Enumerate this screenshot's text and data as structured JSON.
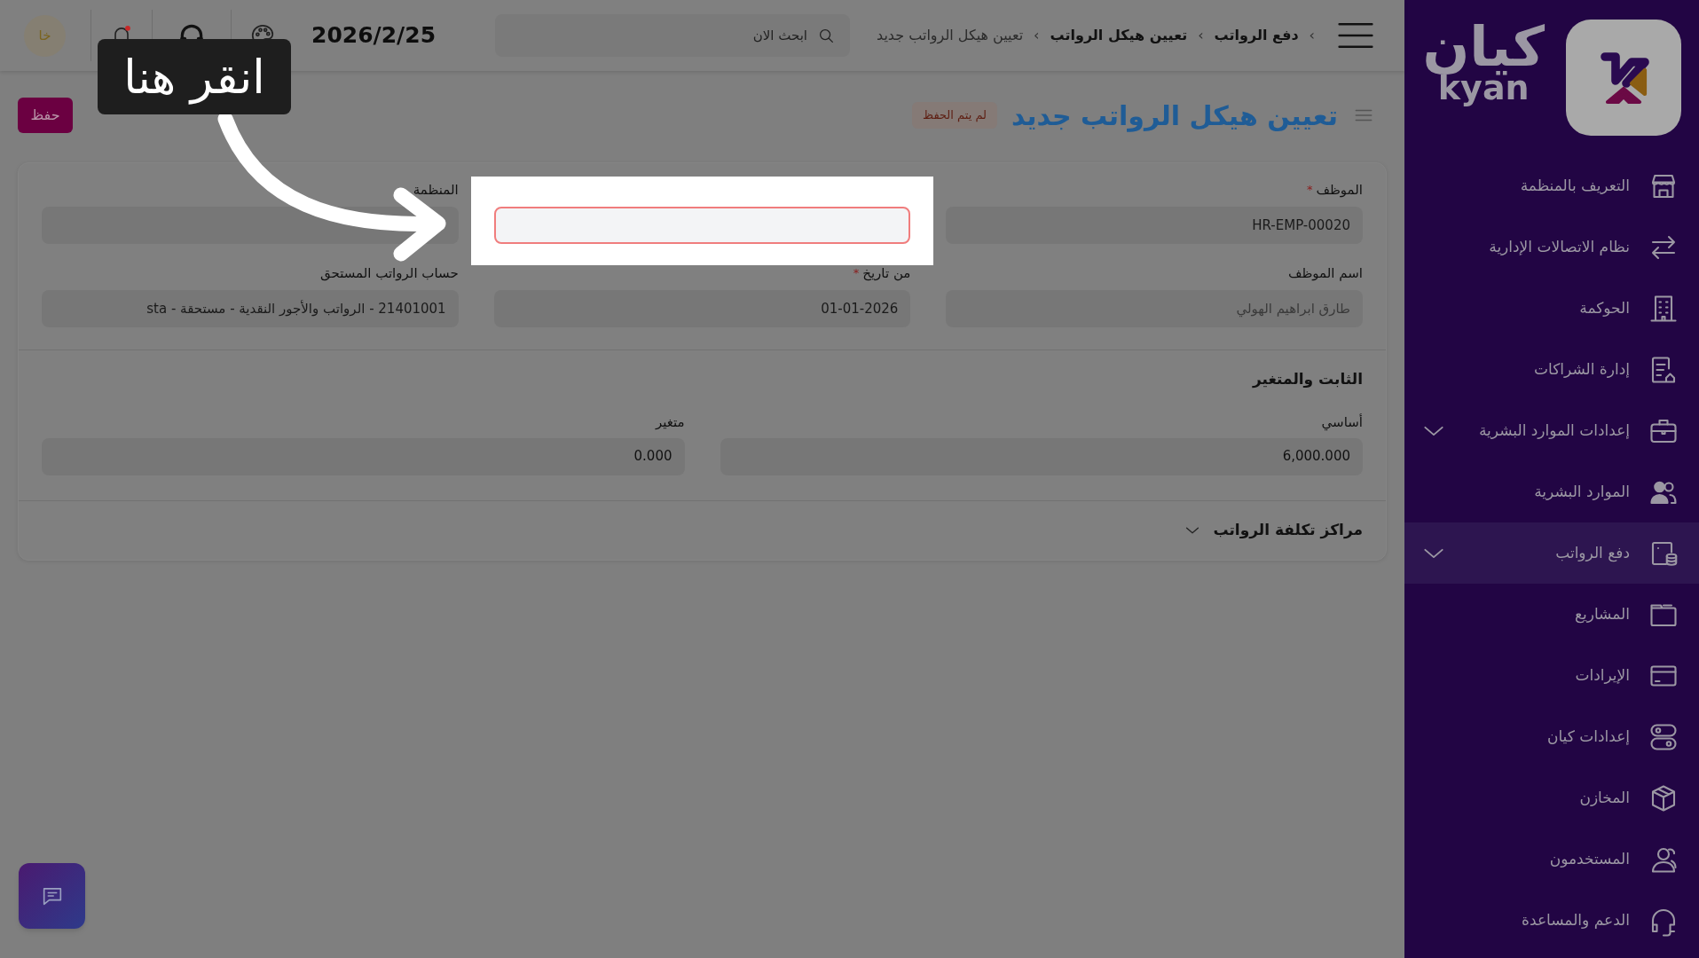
{
  "topbar": {
    "breadcrumbs": [
      {
        "label": "دفع الرواتب",
        "current": false
      },
      {
        "label": "تعيين هيكل الرواتب",
        "current": false
      },
      {
        "label": "تعيين هيكل الرواتب جديد",
        "current": true
      }
    ],
    "breadcrumb_separator": "›",
    "search": {
      "placeholder": "ابحث الان"
    },
    "date": "2026/2/25",
    "notification_dot": true,
    "avatar": "خا"
  },
  "page": {
    "title": "تعيين هيكل الرواتب جديد",
    "status_badge": "لم يتم الحفظ",
    "save_button": "حفظ"
  },
  "form": {
    "rows": [
      [
        {
          "label": "الموظف",
          "required": true,
          "value": "HR-EMP-00020",
          "highlighted": false
        },
        {
          "highlighted": true
        },
        {
          "label": "المنظمة",
          "required": false,
          "highlighted": false
        }
      ],
      [
        {
          "label": "اسم الموظف",
          "required": false,
          "value": "طارق ابراهيم الهولي",
          "highlighted": false,
          "readonly": true
        },
        {
          "label": "من تاريخ",
          "required": true,
          "value": "01-01-2026",
          "highlighted": false
        },
        {
          "label": "حساب الرواتب المستحق",
          "required": false,
          "value": "21401001 - الرواتب والأجور النقدية - مستحقة - sta",
          "highlighted": false
        }
      ]
    ],
    "required_mark": "*",
    "section_title": "الثابت والمتغير",
    "amounts": [
      {
        "label": "أساسي",
        "value": "6,000.000"
      },
      {
        "label": "متغير",
        "value": "0.000"
      }
    ],
    "collapsible": {
      "title": "مراكز تكلفة الرواتب",
      "expanded": false
    }
  },
  "tutorial": {
    "tooltip": "انقر هنا"
  },
  "sidebar": {
    "logo": {
      "arabic": "كيان",
      "latin": "kyan"
    },
    "items": [
      {
        "label": "التعريف بالمنظمة",
        "has_submenu": false,
        "selected": false
      },
      {
        "label": "نظام الاتصالات الإدارية",
        "has_submenu": false,
        "selected": false
      },
      {
        "label": "الحوكمة",
        "has_submenu": false,
        "selected": false
      },
      {
        "label": "إدارة الشراكات",
        "has_submenu": false,
        "selected": false
      },
      {
        "label": "إعدادات الموارد البشرية",
        "has_submenu": true,
        "selected": false
      },
      {
        "label": "الموارد البشرية",
        "has_submenu": false,
        "selected": false
      },
      {
        "label": "دفع الرواتب",
        "has_submenu": true,
        "selected": true
      },
      {
        "label": "المشاريع",
        "has_submenu": false,
        "selected": false
      },
      {
        "label": "الإيرادات",
        "has_submenu": false,
        "selected": false
      },
      {
        "label": "إعدادات كيان",
        "has_submenu": false,
        "selected": false
      },
      {
        "label": "المخازن",
        "has_submenu": false,
        "selected": false
      },
      {
        "label": "المستخدمون",
        "has_submenu": false,
        "selected": false
      },
      {
        "label": "الدعم والمساعدة",
        "has_submenu": false,
        "selected": false
      }
    ]
  }
}
